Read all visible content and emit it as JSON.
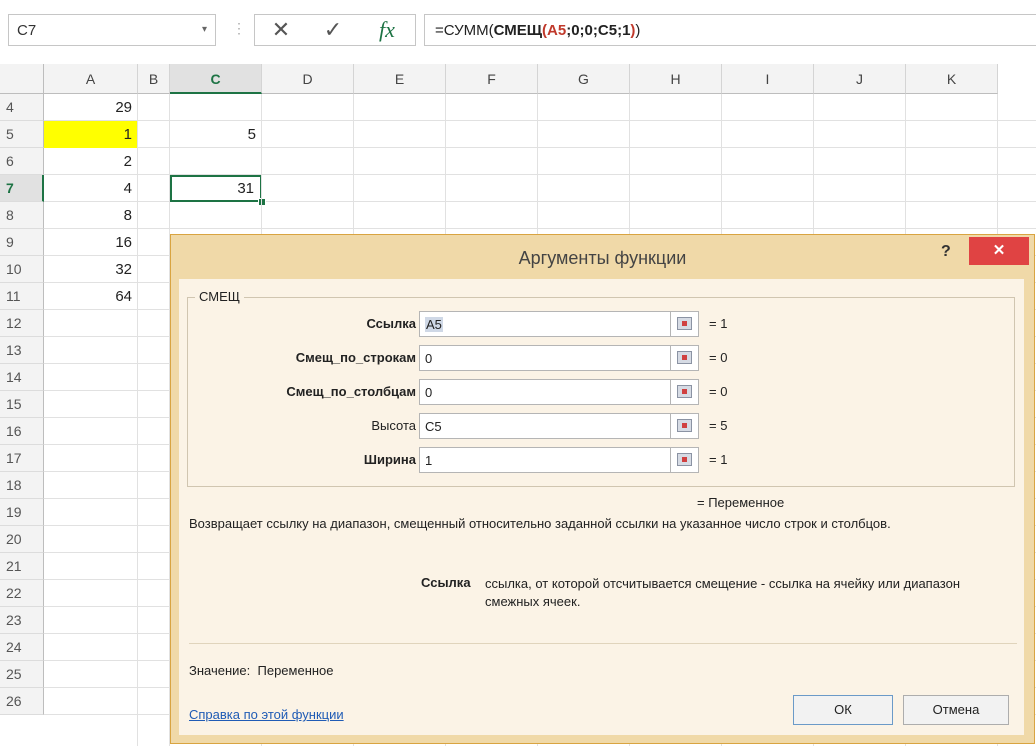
{
  "formula_bar": {
    "name_box": "C7",
    "name_box_arrow": "▾",
    "separator": "⋮",
    "cancel_glyph": "✕",
    "enter_glyph": "✓",
    "fx_glyph": "fx",
    "formula_prefix": "=СУММ(",
    "formula_func": "СМЕЩ",
    "formula_paren_open": "(",
    "formula_ref1": "A5",
    "formula_args": ";0;0;",
    "formula_ref2": "C5",
    "formula_tail": ";1",
    "formula_paren_close": ")",
    "formula_end": ")"
  },
  "sheet": {
    "columns": [
      "A",
      "B",
      "C",
      "D",
      "E",
      "F",
      "G",
      "H",
      "I",
      "J",
      "K"
    ],
    "active_column": "C",
    "rows": [
      "4",
      "5",
      "6",
      "7",
      "8",
      "9",
      "10",
      "11",
      "12",
      "13",
      "14",
      "15",
      "16",
      "17",
      "18",
      "19",
      "20",
      "21",
      "22",
      "23",
      "24",
      "25",
      "26"
    ],
    "active_row": "7",
    "column_a_values": [
      "29",
      "1",
      "2",
      "4",
      "8",
      "16",
      "32",
      "64"
    ],
    "highlight_color": "#ffff00",
    "c5": "5",
    "c7": "31"
  },
  "dialog": {
    "title": "Аргументы функции",
    "help_glyph": "?",
    "close_glyph": "✕",
    "close_color": "#e04343",
    "group_label": "СМЕЩ",
    "args": [
      {
        "label": "Ссылка",
        "value": "A5",
        "result": "=  1"
      },
      {
        "label": "Смещ_по_строкам",
        "value": "0",
        "result": "=  0"
      },
      {
        "label": "Смещ_по_столбцам",
        "value": "0",
        "result": "=  0"
      },
      {
        "label": "Высота",
        "value": "C5",
        "result": "=  5"
      },
      {
        "label": "Ширина",
        "value": "1",
        "result": "=  1"
      }
    ],
    "result_line": "=  Переменное",
    "description": "Возвращает ссылку на диапазон, смещенный относительно заданной ссылки на указанное число строк и столбцов.",
    "arg_desc_name": "Ссылка",
    "arg_desc_text": "ссылка, от которой отсчитывается смещение - ссылка на ячейку или диапазон смежных ячеек.",
    "value_label": "Значение:",
    "value_text": "Переменное",
    "help_link": "Справка по этой функции",
    "ok": "ОК",
    "cancel": "Отмена"
  }
}
